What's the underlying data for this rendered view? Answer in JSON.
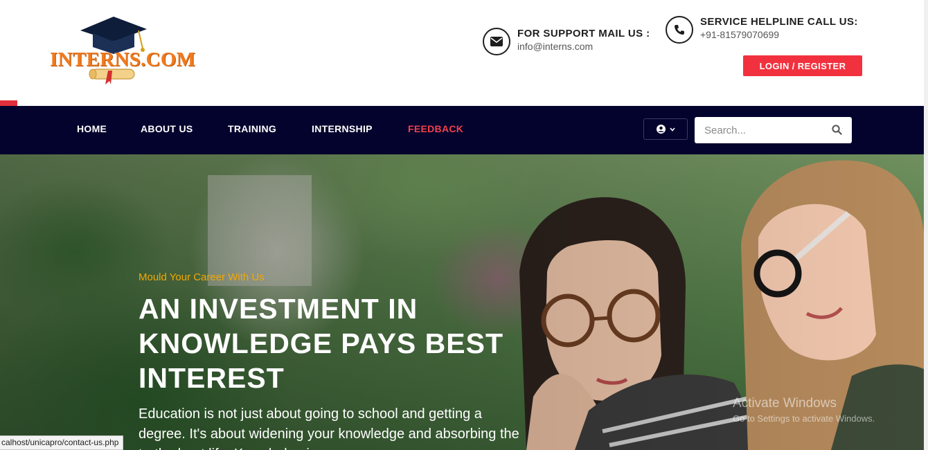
{
  "logo": {
    "text": "INTERNS.COM"
  },
  "contact": {
    "mail_title": "FOR SUPPORT MAIL US :",
    "mail_value": "info@interns.com",
    "phone_title": "SERVICE HELPLINE CALL US:",
    "phone_value": "+91-81579070699"
  },
  "header": {
    "login_label": "LOGIN / REGISTER"
  },
  "nav": {
    "items": [
      {
        "label": "HOME"
      },
      {
        "label": "ABOUT US"
      },
      {
        "label": "TRAINING"
      },
      {
        "label": "INTERNSHIP"
      },
      {
        "label": "FEEDBACK",
        "active": true
      }
    ]
  },
  "search": {
    "placeholder": "Search..."
  },
  "hero": {
    "kicker": "Mould Your Career With Us",
    "title": "AN INVESTMENT IN KNOWLEDGE PAYS BEST INTEREST",
    "text": "Education is not just about going to school and getting a degree. It's about widening your knowledge and absorbing the truth about life. Knowledge is"
  },
  "watermark": {
    "line1": "Activate Windows",
    "line2": "Go to Settings to activate Windows."
  },
  "status_url": "calhost/unicapro/contact-us.php",
  "colors": {
    "navy": "#03032d",
    "accent_red": "#f2313e",
    "kicker_orange": "#f5a800",
    "logo_orange": "#f07a1f"
  },
  "icons": [
    "gear-icon",
    "envelope-icon",
    "phone-icon",
    "user-circle-icon",
    "chevron-down-icon",
    "search-icon",
    "graduation-cap-icon",
    "diploma-scroll-icon"
  ]
}
